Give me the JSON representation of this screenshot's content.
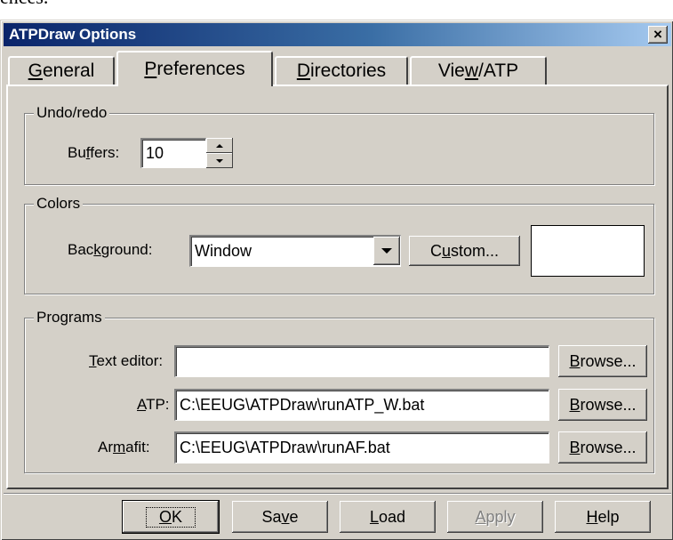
{
  "cropped_text": "ences.",
  "window": {
    "title": "ATPDraw Options",
    "close_label": "×"
  },
  "tabs": [
    {
      "pre": "",
      "ul": "G",
      "post": "eneral"
    },
    {
      "pre": "",
      "ul": "P",
      "post": "references"
    },
    {
      "pre": "",
      "ul": "D",
      "post": "irectories"
    },
    {
      "pre": "Vie",
      "ul": "w",
      "post": "/ATP"
    }
  ],
  "undo": {
    "group_title": "Undo/redo",
    "buffers_label": {
      "pre": "Bu",
      "ul": "f",
      "post": "fers:"
    },
    "buffers_value": "10"
  },
  "colors": {
    "group_title": "Colors",
    "background_label": {
      "pre": "Bac",
      "ul": "k",
      "post": "ground:"
    },
    "background_value": "Window",
    "custom_button": {
      "pre": "C",
      "ul": "u",
      "post": "stom..."
    },
    "preview_color": "#ffffff"
  },
  "programs": {
    "group_title": "Programs",
    "text_editor": {
      "label": {
        "pre": "",
        "ul": "T",
        "post": "ext editor:"
      },
      "value": ""
    },
    "atp": {
      "label": {
        "pre": "",
        "ul": "A",
        "post": "TP:"
      },
      "value": "C:\\EEUG\\ATPDraw\\runATP_W.bat"
    },
    "armafit": {
      "label": {
        "pre": "Ar",
        "ul": "m",
        "post": "afit:"
      },
      "value": "C:\\EEUG\\ATPDraw\\runAF.bat"
    },
    "browse": {
      "pre": "",
      "ul": "B",
      "post": "rowse..."
    }
  },
  "footer": {
    "ok": {
      "pre": "",
      "ul": "O",
      "post": "K"
    },
    "save": {
      "pre": "Sa",
      "ul": "v",
      "post": "e"
    },
    "load": {
      "pre": "",
      "ul": "L",
      "post": "oad"
    },
    "apply": {
      "pre": "",
      "ul": "A",
      "post": "pply"
    },
    "help": {
      "pre": "",
      "ul": "H",
      "post": "elp"
    }
  },
  "colors_theme": {
    "title_start": "#0a246a",
    "face": "#d4d0c8"
  }
}
